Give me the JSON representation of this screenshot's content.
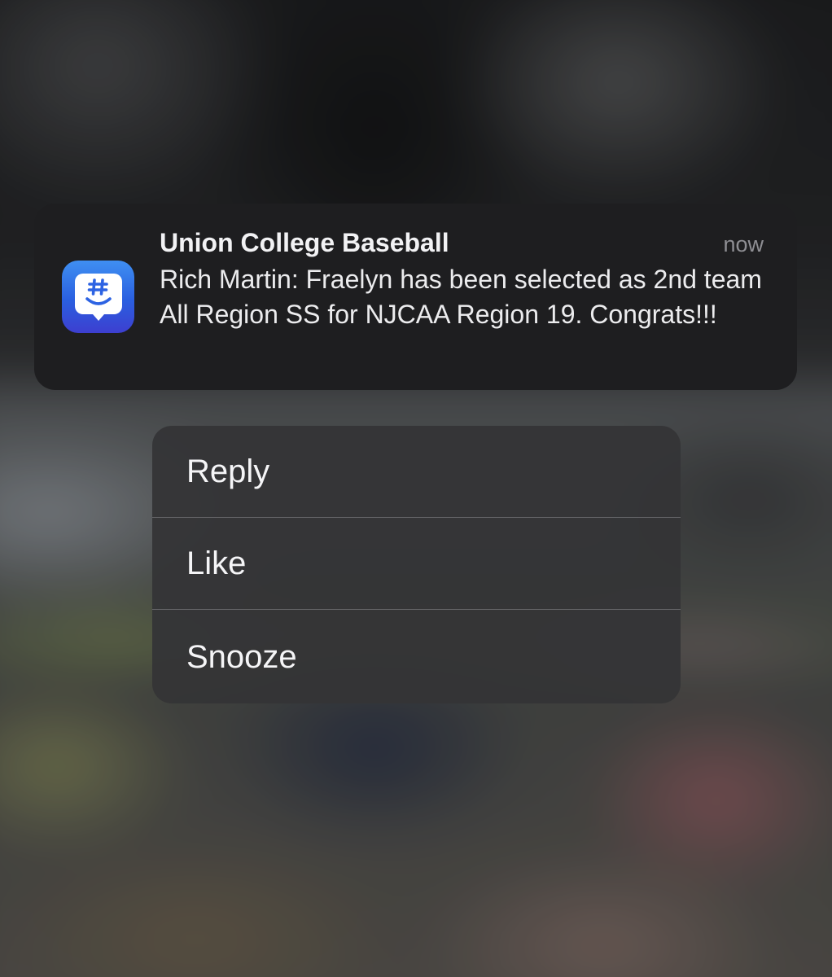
{
  "notification": {
    "app_name": "Union College Baseball",
    "time": "now",
    "body": "Rich Martin: Fraelyn has been selected as 2nd team All Region SS for NJCAA Region 19. Congrats!!!",
    "app_icon": "groupme-icon",
    "icon_colors": [
      "#3f8ff2",
      "#3d3fd0"
    ]
  },
  "actions": [
    {
      "label": "Reply"
    },
    {
      "label": "Like"
    },
    {
      "label": "Snooze"
    }
  ]
}
